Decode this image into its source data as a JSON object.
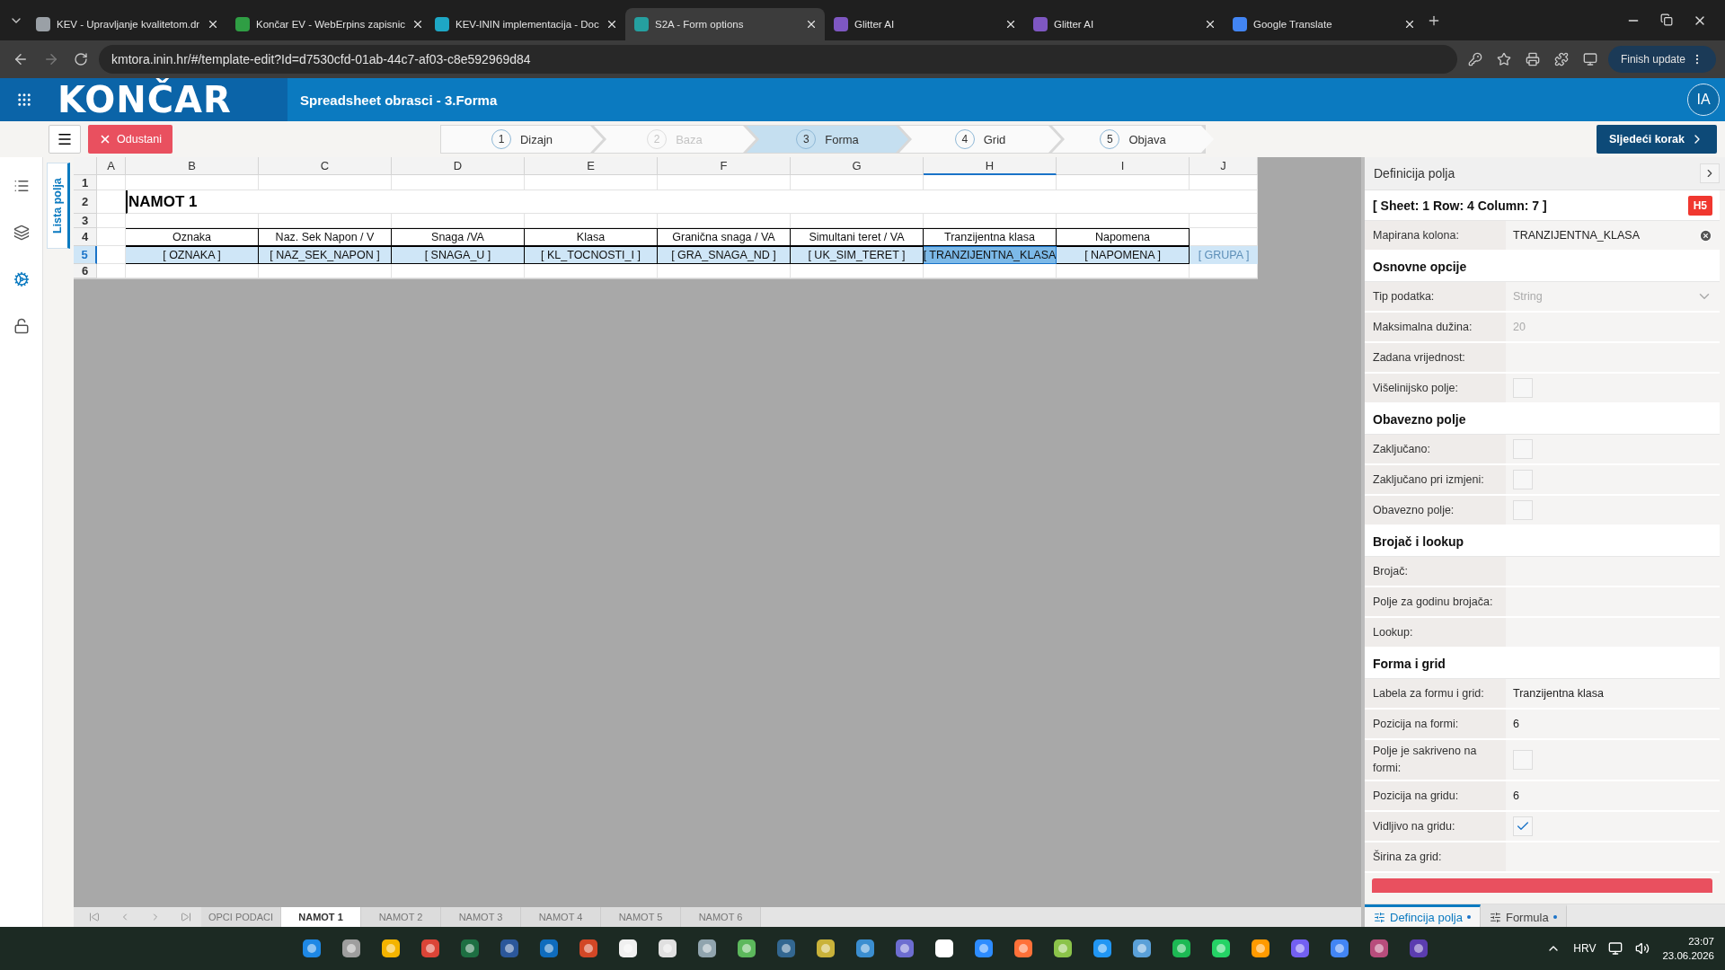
{
  "browser": {
    "tabs": [
      {
        "title": "KEV - Upravljanje kvalitetom.dr",
        "selected": false
      },
      {
        "title": "Končar EV - WebErpins zapisnic",
        "selected": false
      },
      {
        "title": "KEV-ININ implementacija - Doc",
        "selected": false
      },
      {
        "title": "S2A - Form options",
        "selected": true
      },
      {
        "title": "Glitter AI",
        "selected": false
      },
      {
        "title": "Glitter AI",
        "selected": false
      },
      {
        "title": "Google Translate",
        "selected": false
      }
    ],
    "url": "kmtora.inin.hr/#/template-edit?Id=d7530cfd-01ab-44c7-af03-c8e592969d84",
    "update_button": "Finish update"
  },
  "app": {
    "logo": "KONČAR",
    "title": "Spreadsheet obrasci - 3.Forma",
    "avatar": "IA"
  },
  "toolbar": {
    "cancel": "Odustani",
    "next": "Sljedeći korak",
    "steps": [
      {
        "number": "1",
        "label": "Dizajn",
        "selected": false,
        "disabled": false
      },
      {
        "number": "2",
        "label": "Baza",
        "selected": false,
        "disabled": true
      },
      {
        "number": "3",
        "label": "Forma",
        "selected": true,
        "disabled": false
      },
      {
        "number": "4",
        "label": "Grid",
        "selected": false,
        "disabled": false
      },
      {
        "number": "5",
        "label": "Objava",
        "selected": false,
        "disabled": false
      }
    ]
  },
  "side_tab": "Lista polja",
  "sheet": {
    "columns": [
      {
        "label": "A",
        "selected": false
      },
      {
        "label": "B",
        "selected": false
      },
      {
        "label": "C",
        "selected": false
      },
      {
        "label": "D",
        "selected": false
      },
      {
        "label": "E",
        "selected": false
      },
      {
        "label": "F",
        "selected": false
      },
      {
        "label": "G",
        "selected": false
      },
      {
        "label": "H",
        "selected": true
      },
      {
        "label": "I",
        "selected": false
      },
      {
        "label": "J",
        "selected": false
      }
    ],
    "rows": [
      {
        "number": "1",
        "kind": "empty",
        "selected": false
      },
      {
        "number": "2",
        "kind": "title",
        "selected": false,
        "text": "NAMOT 1"
      },
      {
        "number": "3",
        "kind": "empty",
        "selected": false
      },
      {
        "number": "4",
        "kind": "header",
        "selected": false,
        "cells": [
          {
            "text": "Oznaka",
            "selected": false
          },
          {
            "text": "Naz. Sek Napon / V",
            "selected": false
          },
          {
            "text": "Snaga /VA",
            "selected": false
          },
          {
            "text": "Klasa",
            "selected": false
          },
          {
            "text": "Granična snaga / VA",
            "selected": false
          },
          {
            "text": "Simultani teret / VA",
            "selected": false
          },
          {
            "text": "Tranzijentna klasa",
            "selected": false
          },
          {
            "text": "Napomena",
            "selected": false
          }
        ]
      },
      {
        "number": "5",
        "kind": "field",
        "selected": true,
        "cells": [
          {
            "text": "[ OZNAKA ]",
            "selected": false
          },
          {
            "text": "[ NAZ_SEK_NAPON ]",
            "selected": false
          },
          {
            "text": "[ SNAGA_U ]",
            "selected": false
          },
          {
            "text": "[ KL_TOCNOSTI_I ]",
            "selected": false
          },
          {
            "text": "[ GRA_SNAGA_ND ]",
            "selected": false
          },
          {
            "text": "[ UK_SIM_TERET ]",
            "selected": false
          },
          {
            "text": "[ TRANZIJENTNA_KLASA",
            "selected": true
          },
          {
            "text": "[ NAPOMENA ]",
            "selected": false
          },
          {
            "text": "[ GRUPA ]",
            "selected": false,
            "hidden_field": true
          }
        ]
      },
      {
        "number": "6",
        "kind": "empty",
        "selected": false
      }
    ]
  },
  "sheet_tabs": [
    {
      "label": "OPCI PODACI",
      "selected": false
    },
    {
      "label": "NAMOT 1",
      "selected": true
    },
    {
      "label": "NAMOT 2",
      "selected": false
    },
    {
      "label": "NAMOT 3",
      "selected": false
    },
    {
      "label": "NAMOT 4",
      "selected": false
    },
    {
      "label": "NAMOT 5",
      "selected": false
    },
    {
      "label": "NAMOT 6",
      "selected": false
    }
  ],
  "panel": {
    "title": "Definicija polja",
    "location": "[ Sheet: 1 Row: 4 Column: 7 ]",
    "cell_badge": "H5",
    "mapped": {
      "label": "Mapirana kolona:",
      "value": "TRANZIJENTNA_KLASA"
    },
    "sections": [
      {
        "heading": "Osnovne opcije",
        "fields": [
          {
            "kind": "select",
            "label": "Tip podatka:",
            "value": "String",
            "disabled": true
          },
          {
            "kind": "text",
            "label": "Maksimalna dužina:",
            "value": "20",
            "disabled": true
          },
          {
            "kind": "text",
            "label": "Zadana vrijednost:"
          },
          {
            "kind": "checkbox",
            "label": "Višelinijsko polje:",
            "checked": false
          }
        ]
      },
      {
        "heading": "Obavezno polje",
        "fields": [
          {
            "kind": "checkbox",
            "label": "Zaključano:",
            "checked": false
          },
          {
            "kind": "checkbox",
            "label": "Zaključano pri izmjeni:",
            "checked": false
          },
          {
            "kind": "checkbox",
            "label": "Obavezno polje:",
            "checked": false
          }
        ]
      },
      {
        "heading": "Brojač i lookup",
        "fields": [
          {
            "kind": "text",
            "label": "Brojač:"
          },
          {
            "kind": "text",
            "label": "Polje za godinu brojača:"
          },
          {
            "kind": "text",
            "label": "Lookup:"
          }
        ]
      },
      {
        "heading": "Forma i grid",
        "fields": [
          {
            "kind": "text",
            "label": "Labela za formu i grid:",
            "value": "Tranzijentna klasa",
            "disabled": false
          },
          {
            "kind": "text",
            "label": "Pozicija na formi:",
            "value": "6",
            "disabled": false
          },
          {
            "kind": "checkbox",
            "label": "Polje je sakriveno na formi:",
            "checked": false
          },
          {
            "kind": "text",
            "label": "Pozicija na gridu:",
            "value": "6",
            "disabled": false
          },
          {
            "kind": "checkbox",
            "label": "Vidljivo na gridu:",
            "checked": true
          },
          {
            "kind": "text",
            "label": "Širina za grid:"
          }
        ]
      }
    ],
    "tabs": [
      {
        "label": "Defincija polja",
        "selected": true
      },
      {
        "label": "Formula",
        "selected": false
      }
    ]
  },
  "taskbar": {
    "language": "HRV",
    "time": "23:07",
    "date": "23.06.2026"
  }
}
